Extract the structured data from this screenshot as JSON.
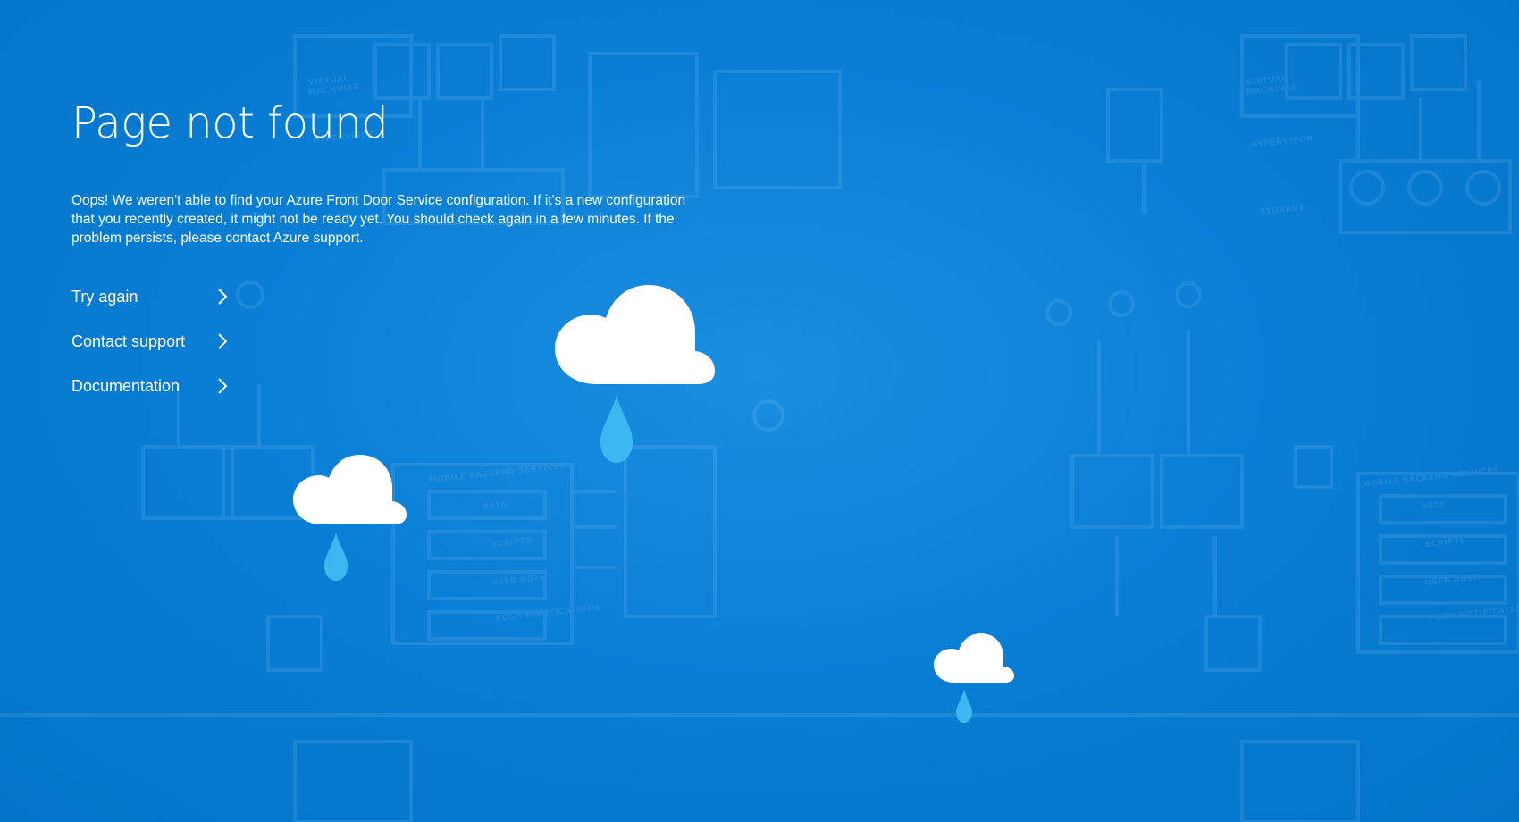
{
  "page": {
    "title": "Page not found",
    "message": "Oops! We weren't able to find your Azure Front Door Service configuration. If it's a new configuration that you recently created, it might not be ready yet. You should check again in a few minutes. If the problem persists, please contact Azure support."
  },
  "links": [
    {
      "label": "Try again",
      "icon": "chevron-right-icon"
    },
    {
      "label": "Contact support",
      "icon": "chevron-right-icon"
    },
    {
      "label": "Documentation",
      "icon": "chevron-right-icon"
    }
  ],
  "background": {
    "labels": [
      "VIRTUAL MACHINES",
      "HYPERVISOR",
      "STORAGE",
      "MOBILE BACKEND SERVICES",
      "DATA",
      "SCRIPTS",
      "USER AUTH",
      "PUSH NOTIFICATIONS"
    ]
  },
  "colors": {
    "background": "#0a7fd6",
    "text": "#ffffff",
    "raindrop": "#3bb8ef",
    "cloud": "#ffffff"
  }
}
